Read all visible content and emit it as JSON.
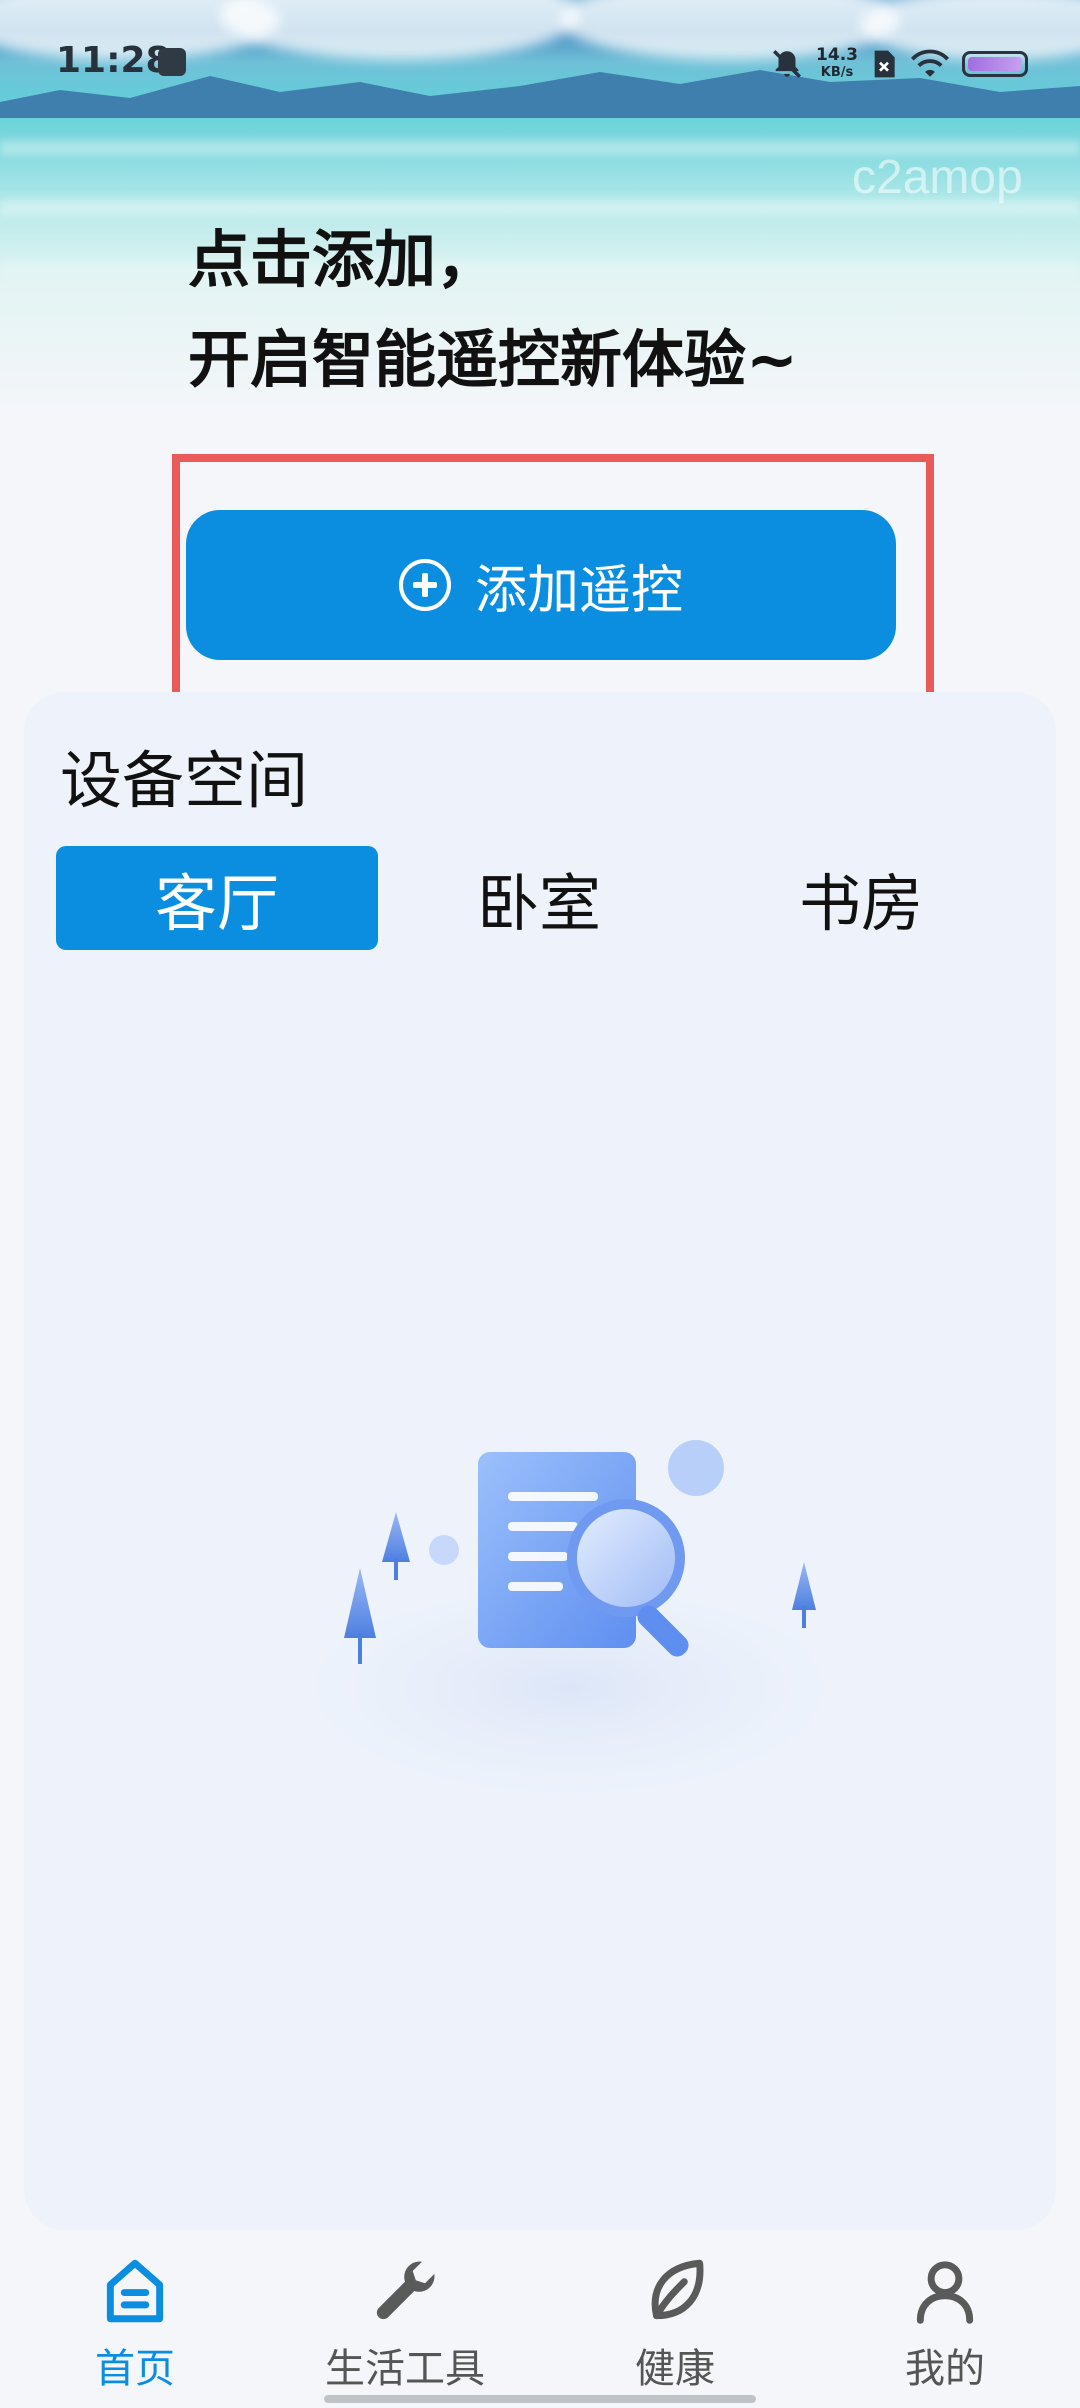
{
  "status_bar": {
    "time": "11:28",
    "net_speed_value": "14.3",
    "net_speed_unit": "KB/s"
  },
  "watermark": "c2amop",
  "hero": {
    "line1": "点击添加，",
    "line2": "开启智能遥控新体验~"
  },
  "add_button": {
    "label": "添加遥控"
  },
  "device_space": {
    "title": "设备空间",
    "rooms": [
      "客厅",
      "卧室",
      "书房"
    ],
    "selected_room": "客厅"
  },
  "bottom_nav": {
    "items": [
      {
        "label": "首页",
        "icon": "home-icon",
        "active": true
      },
      {
        "label": "生活工具",
        "icon": "wrench-icon",
        "active": false
      },
      {
        "label": "健康",
        "icon": "leaf-icon",
        "active": false
      },
      {
        "label": "我的",
        "icon": "person-icon",
        "active": false
      }
    ]
  },
  "colors": {
    "accent": "#0b8ee0",
    "highlight_border": "#ea5a58",
    "card_bg": "#eef3fb",
    "page_bg": "#f4f6fa"
  }
}
